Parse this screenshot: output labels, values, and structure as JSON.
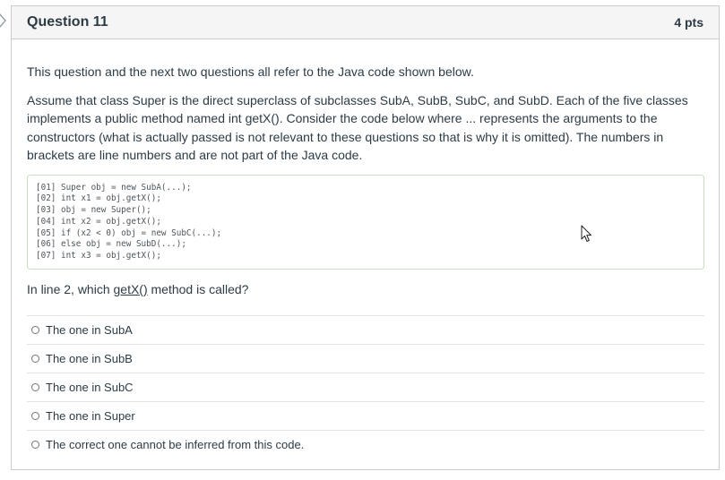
{
  "question": {
    "title": "Question 11",
    "points": "4 pts"
  },
  "body": {
    "intro": "This question and the next two questions all refer to the Java code shown below.",
    "description": "Assume that class Super is the direct superclass of subclasses SubA, SubB, SubC, and SubD. Each of the five classes implements a public method named int getX(). Consider the code below where ... represents the arguments to the constructors (what is actually passed is not relevant to these questions so that is why it is omitted). The numbers in brackets are line numbers and are not part of the Java code."
  },
  "code": {
    "lines": [
      "[01] Super obj = new SubA(...);",
      "[02] int x1 = obj.getX();",
      "[03] obj = new Super();",
      "[04] int x2 = obj.getX();",
      "[05] if (x2 < 0) obj = new SubC(...);",
      "[06] else obj = new SubD(...);",
      "[07] int x3 = obj.getX();"
    ]
  },
  "prompt": {
    "before": "In line 2, which ",
    "method": "getX()",
    "after": " method is called?"
  },
  "answers": [
    {
      "label": "The one in SubA"
    },
    {
      "label": "The one in SubB"
    },
    {
      "label": "The one in SubC"
    },
    {
      "label": "The one in Super"
    },
    {
      "label": "The correct one cannot be inferred from this code."
    }
  ],
  "icons": {
    "side": "chevron-right-icon",
    "pointer": "mouse-cursor-icon",
    "radio": "radio-unchecked-icon"
  },
  "colors": {
    "text": "#2d3b45",
    "header_bg": "#f5f5f5",
    "border": "#c7cdd1",
    "code_border": "#c9e2bd"
  }
}
